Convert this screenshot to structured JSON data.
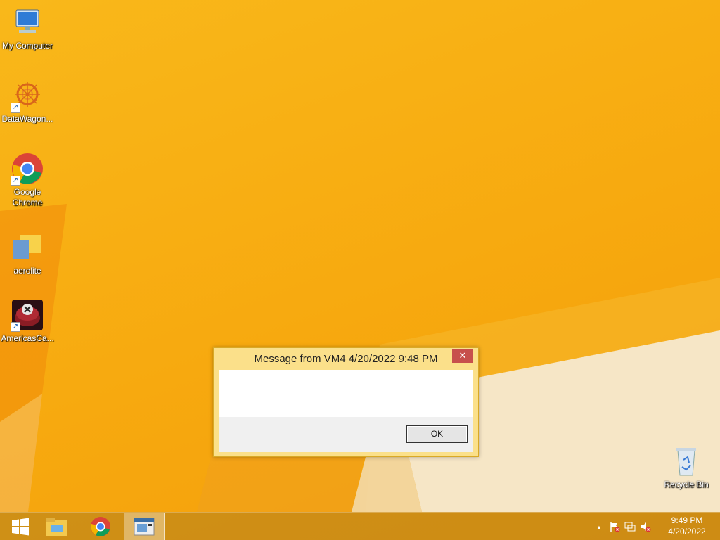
{
  "desktop": {
    "icons": [
      {
        "label": "My Computer",
        "icon": "computer-icon"
      },
      {
        "label": "DataWagon...",
        "icon": "datawagon-icon"
      },
      {
        "label": "Google Chrome",
        "icon": "chrome-icon"
      },
      {
        "label": "aerolite",
        "icon": "folder-icon"
      },
      {
        "label": "AmericasCa...",
        "icon": "casino-chip-icon"
      },
      {
        "label": "Recycle Bin",
        "icon": "recycle-bin-icon"
      }
    ]
  },
  "dialog": {
    "title": "Message from VM4 4/20/2022 9:48 PM",
    "close_glyph": "✕",
    "message": "",
    "ok_label": "OK"
  },
  "taskbar": {
    "start_icon": "windows-start-icon",
    "pinned": [
      "file-explorer-icon",
      "chrome-icon",
      "message-window-icon"
    ],
    "tray": {
      "show_hidden_glyph": "▲",
      "icons": [
        "action-center-flag-icon",
        "network-icon",
        "volume-muted-icon"
      ],
      "time": "9:49 PM",
      "date": "4/20/2022"
    }
  },
  "colors": {
    "wallpaper": "#f7a90f",
    "dialog_frame": "#fbe08a",
    "close_button": "#c7504c"
  }
}
